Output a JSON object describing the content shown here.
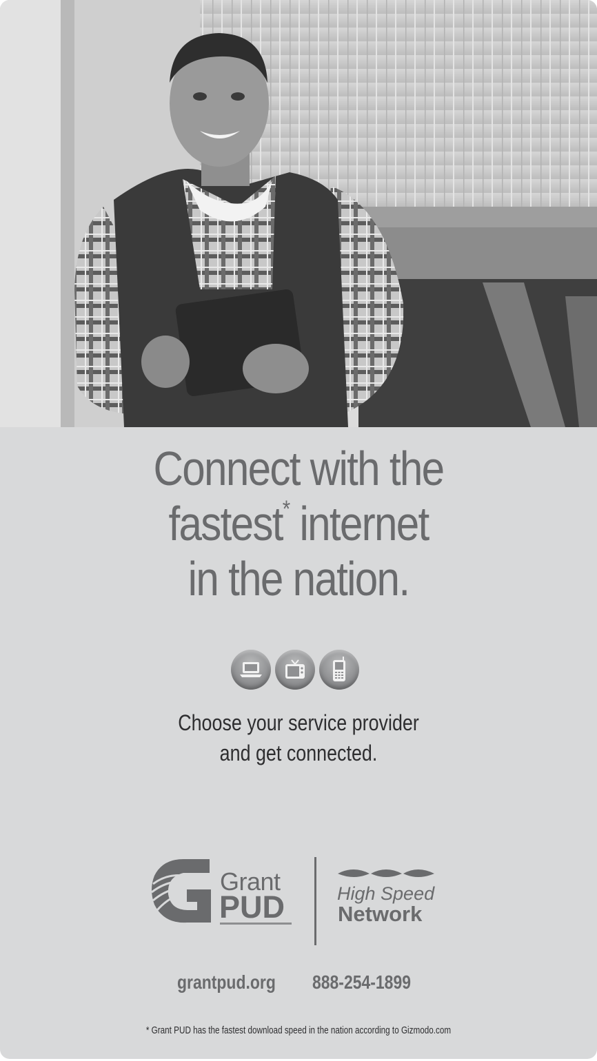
{
  "headline": {
    "line1": "Connect with the",
    "line2_pre": "fastest",
    "line2_mark": "*",
    "line2_post": " internet",
    "line3": "in the nation."
  },
  "icons": [
    "laptop-icon",
    "tv-icon",
    "mobile-phone-icon"
  ],
  "subhead": {
    "line1": "Choose your service provider",
    "line2": "and get connected."
  },
  "logos": {
    "grant_word": "Grant",
    "pud_word": "PUD",
    "hsn_line1": "High Speed",
    "hsn_line2": "Network"
  },
  "contact": {
    "website": "grantpud.org",
    "phone": "888-254-1899"
  },
  "footnote": "* Grant PUD has the fastest download speed in the nation according to Gizmodo.com",
  "colors": {
    "background": "#d8d9da",
    "headline": "#6a6b6d",
    "body_text": "#2e2e30"
  }
}
